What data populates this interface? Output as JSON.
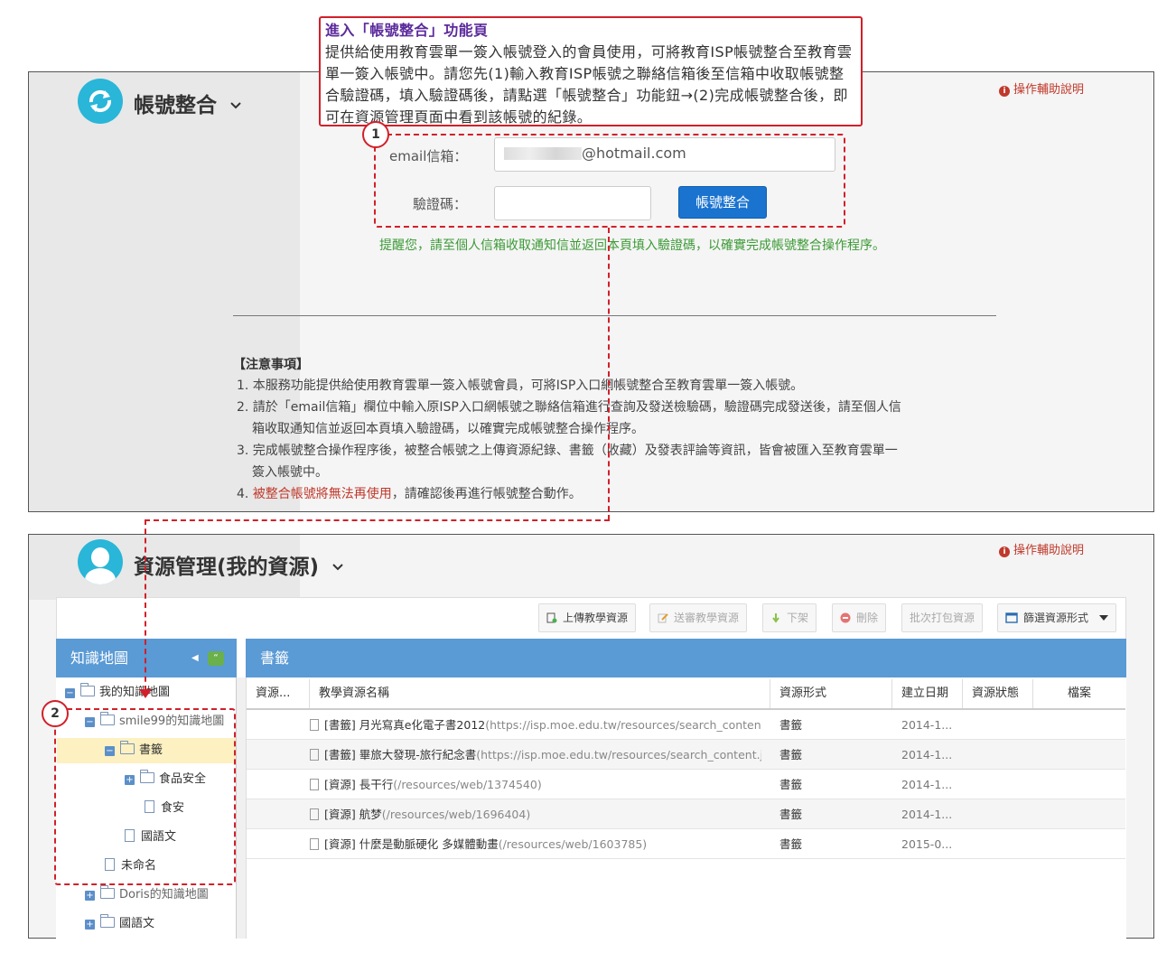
{
  "callout": {
    "title": "進入「帳號整合」功能頁",
    "body": "提供給使用教育雲單一簽入帳號登入的會員使用，可將教育ISP帳號整合至教育雲單一簽入帳號中。請您先(1)輸入教育ISP帳號之聯絡信箱後至信箱中收取帳號整合驗證碼，填入驗證碼後，請點選「帳號整合」功能鈕→(2)完成帳號整合後，即可在資源管理頁面中看到該帳號的紀錄。"
  },
  "account_page": {
    "icon": "sync-icon",
    "title": "帳號整合",
    "help": "操作輔助說明",
    "email_label": "email信箱：",
    "email_value": "@hotmail.com",
    "code_label": "驗證碼：",
    "code_value": "",
    "submit": "帳號整合",
    "reminder": "提醒您，請至個人信箱收取通知信並返回本頁填入驗證碼，以確實完成帳號整合操作程序。",
    "notice_title": "【注意事項】",
    "notices": [
      "1. 本服務功能提供給使用教育雲單一簽入帳號會員，可將ISP入口網帳號整合至教育雲單一簽入帳號。",
      "2. 請於「email信箱」欄位中輸入原ISP入口網帳號之聯絡信箱進行查詢及發送檢驗碼，驗證碼完成發送後，請至個人信",
      "箱收取通知信並返回本頁填入驗證碼，以確實完成帳號整合操作程序。",
      "3. 完成帳號整合操作程序後，被整合帳號之上傳資源紀錄、書籤（收藏）及發表評論等資訊，皆會被匯入至教育雲單一",
      "簽入帳號中。"
    ],
    "notice4_prefix": "4. ",
    "notice4_red": "被整合帳號將無法再使用",
    "notice4_rest": "，請確認後再進行帳號整合動作。"
  },
  "steps": [
    "1",
    "2"
  ],
  "resource_page": {
    "icon": "user-icon",
    "title": "資源管理(我的資源)",
    "help": "操作輔助說明",
    "toolbar": [
      "上傳教學資源",
      "送審教學資源",
      "下架",
      "刪除",
      "批次打包資源",
      "篩選資源形式"
    ],
    "tree_title": "知識地圖",
    "tree_badge": "“",
    "tree": [
      "我的知識地圖",
      "smile99的知識地圖",
      "書籤",
      "食品安全",
      "食安",
      "國語文",
      "未命名",
      "Doris的知識地圖",
      "國語文"
    ],
    "table_title": "書籤",
    "columns": [
      "資源...",
      "教學資源名稱",
      "資源形式",
      "建立日期",
      "資源狀態",
      "檔案"
    ],
    "rows": [
      {
        "name": "[書籤] 月光寫真e化電子書2012",
        "url": "(https://isp.moe.edu.tw/resources/search_content...",
        "type": "書籤",
        "date": "2014-1..."
      },
      {
        "name": "[書籤] 畢旅大發現-旅行紀念書",
        "url": "(https://isp.moe.edu.tw/resources/search_content.j...",
        "type": "書籤",
        "date": "2014-1..."
      },
      {
        "name": "[資源] 長干行",
        "url": "(/resources/web/1374540)",
        "type": "書籤",
        "date": "2014-1..."
      },
      {
        "name": "[資源] 航梦",
        "url": "(/resources/web/1696404)",
        "type": "書籤",
        "date": "2014-1..."
      },
      {
        "name": "[資源] 什麼是動脈硬化 多媒體動畫",
        "url": "(/resources/web/1603785)",
        "type": "書籤",
        "date": "2015-0..."
      }
    ]
  },
  "colors": {
    "accent": "#d2202a",
    "brand": "#29b6d8",
    "primary": "#1a73cf",
    "header": "#5a9ad5",
    "reminder": "#3c9a36"
  }
}
